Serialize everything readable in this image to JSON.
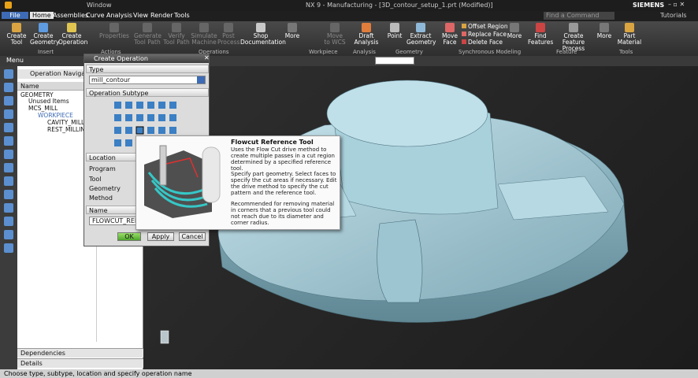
{
  "window": {
    "title": "NX 9 - Manufacturing - [3D_contour_setup_1.prt (Modified)]",
    "window_menu": "Window",
    "brand": "SIEMENS"
  },
  "menubar": {
    "items": [
      "File",
      "Home",
      "Assemblies",
      "Curve",
      "Analysis",
      "View",
      "Render",
      "Tools"
    ],
    "search_placeholder": "Find a Command",
    "tutorials": "Tutorials"
  },
  "ribbon": {
    "buttons": [
      {
        "label": "Create\nTool"
      },
      {
        "label": "Create\nGeometry"
      },
      {
        "label": "Create\nOperation"
      },
      {
        "label": "Properties"
      },
      {
        "label": "Generate\nTool Path"
      },
      {
        "label": "Verify\nTool Path"
      },
      {
        "label": "Simulate\nMachine"
      },
      {
        "label": "Post\nProcess"
      },
      {
        "label": "Shop\nDocumentation"
      },
      {
        "label": "More"
      },
      {
        "label": "Move\nto WCS"
      },
      {
        "label": "Draft\nAnalysis"
      },
      {
        "label": "Point"
      },
      {
        "label": "Extract\nGeometry"
      },
      {
        "label": "Move\nFace"
      },
      {
        "label": "More"
      },
      {
        "label": "Find\nFeatures"
      },
      {
        "label": "Create Feature\nProcess"
      },
      {
        "label": "More"
      },
      {
        "label": "Part\nMaterial"
      }
    ],
    "face_menu": [
      "Offset Region",
      "Replace Face",
      "Delete Face"
    ],
    "groups": [
      "Insert",
      "Actions",
      "Operations",
      "Workpiece",
      "Analysis",
      "Geometry",
      "Synchronous Modeling",
      "Feature",
      "Tools"
    ]
  },
  "toolbar2": {
    "menu": "Menu"
  },
  "navigator": {
    "title": "Operation Navigator",
    "column": "Name",
    "items": [
      "GEOMETRY",
      "Unused Items",
      "MCS_MILL",
      "WORKPIECE",
      "CAVITY_MILL",
      "REST_MILLING"
    ],
    "footer": [
      "Dependencies",
      "Details"
    ]
  },
  "dialog": {
    "title": "Create Operation",
    "type_label": "Type",
    "type_value": "mill_contour",
    "subtype_label": "Operation Subtype",
    "location_label": "Location",
    "location_fields": [
      "Program",
      "Tool",
      "Geometry",
      "Method"
    ],
    "name_label": "Name",
    "name_value": "FLOWCUT_REF_T",
    "buttons": {
      "ok": "OK",
      "apply": "Apply",
      "cancel": "Cancel"
    }
  },
  "tooltip": {
    "title": "Flowcut Reference Tool",
    "p1": "Uses the Flow Cut drive method to create multiple passes in a cut region determined by a specified reference tool.",
    "p2": "Specify part geometry. Select faces to specify the cut areas if necessary. Edit the drive method to specify the cut pattern and the reference tool.",
    "p3": "Recommended for removing material in corners that a previous tool could not reach due to its diameter and corner radius."
  },
  "status": {
    "prompt": "Choose type, subtype, location and specify operation name"
  },
  "colors": {
    "accent": "#3e6bb5",
    "part": "#a9d1dc"
  }
}
